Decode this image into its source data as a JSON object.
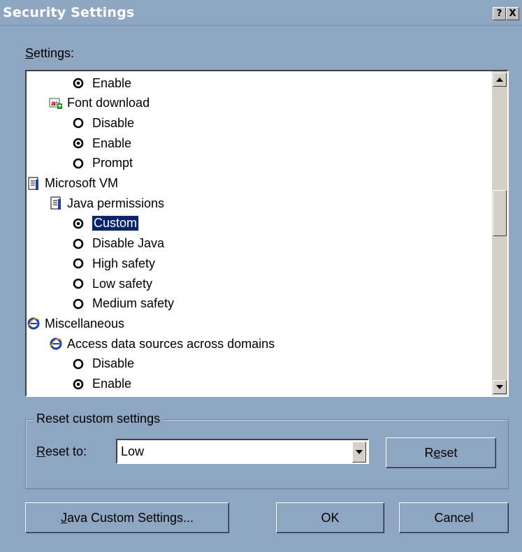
{
  "window": {
    "title": "Security Settings",
    "help_glyph": "?",
    "close_glyph": "X"
  },
  "settings": {
    "label_mnemonic": "S",
    "label_rest": "ettings:",
    "items": [
      {
        "text": "Enable",
        "kind": "radio",
        "checked": true,
        "indent": 2
      },
      {
        "text": "Font download",
        "kind": "group",
        "icon": "font-download-icon",
        "indent": 1
      },
      {
        "text": "Disable",
        "kind": "radio",
        "checked": false,
        "indent": 2
      },
      {
        "text": "Enable",
        "kind": "radio",
        "checked": true,
        "indent": 2
      },
      {
        "text": "Prompt",
        "kind": "radio",
        "checked": false,
        "indent": 2
      },
      {
        "text": "Microsoft VM",
        "kind": "group",
        "icon": "document-icon",
        "indent": 0
      },
      {
        "text": "Java permissions",
        "kind": "group",
        "icon": "document-icon",
        "indent": 1
      },
      {
        "text": "Custom",
        "kind": "radio",
        "checked": true,
        "indent": 2,
        "selected": true
      },
      {
        "text": "Disable Java",
        "kind": "radio",
        "checked": false,
        "indent": 2
      },
      {
        "text": "High safety",
        "kind": "radio",
        "checked": false,
        "indent": 2
      },
      {
        "text": "Low safety",
        "kind": "radio",
        "checked": false,
        "indent": 2
      },
      {
        "text": "Medium safety",
        "kind": "radio",
        "checked": false,
        "indent": 2
      },
      {
        "text": "Miscellaneous",
        "kind": "group",
        "icon": "ie-icon",
        "indent": 0
      },
      {
        "text": "Access data sources across domains",
        "kind": "group",
        "icon": "ie-icon",
        "indent": 1
      },
      {
        "text": "Disable",
        "kind": "radio",
        "checked": false,
        "indent": 2
      },
      {
        "text": "Enable",
        "kind": "radio",
        "checked": true,
        "indent": 2
      }
    ]
  },
  "reset": {
    "group_label": "Reset custom settings",
    "reset_to_mnemonic": "R",
    "reset_to_rest": "eset to:",
    "combo_value": "Low",
    "button_pre": "R",
    "button_mnemonic": "e",
    "button_post": "set"
  },
  "buttons": {
    "java_mnemonic": "J",
    "java_rest": "ava Custom Settings...",
    "ok": "OK",
    "cancel": "Cancel"
  },
  "colors": {
    "window": "#8fa6c3",
    "selection": "#0a246a"
  }
}
